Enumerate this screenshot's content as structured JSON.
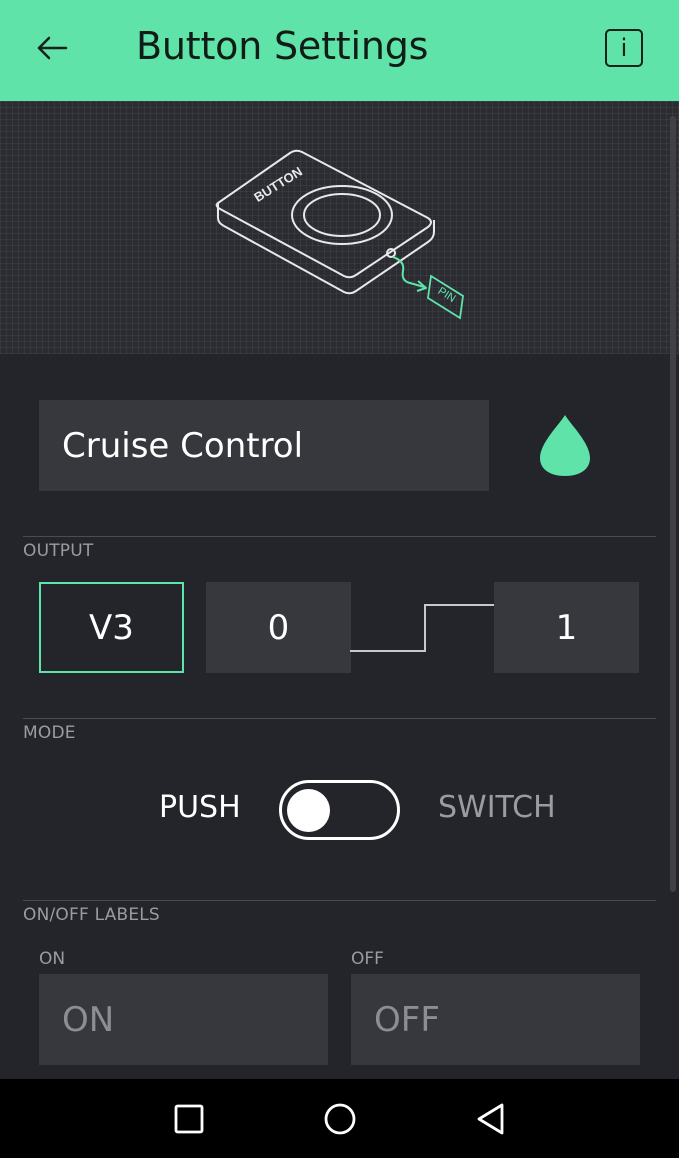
{
  "header": {
    "title": "Button Settings",
    "back_icon": "arrow-left-icon",
    "info_label": "i",
    "background_color": "#5fe3a9"
  },
  "illustration": {
    "button_text": "BUTTON",
    "pin_text": "PIN"
  },
  "name_field": {
    "value": "Cruise Control",
    "color_icon": "droplet-icon",
    "widget_color": "#5fe3a9"
  },
  "output": {
    "section_title": "OUTPUT",
    "pin": "V3",
    "low_value": "0",
    "high_value": "1"
  },
  "mode": {
    "section_title": "MODE",
    "push_label": "PUSH",
    "switch_label": "SWITCH",
    "selected": "PUSH"
  },
  "labels": {
    "section_title": "ON/OFF LABELS",
    "on_caption": "ON",
    "off_caption": "OFF",
    "on_placeholder": "ON",
    "off_placeholder": "OFF"
  },
  "navbar": {
    "icons": [
      "recent-apps-icon",
      "home-icon",
      "back-triangle-icon"
    ]
  }
}
